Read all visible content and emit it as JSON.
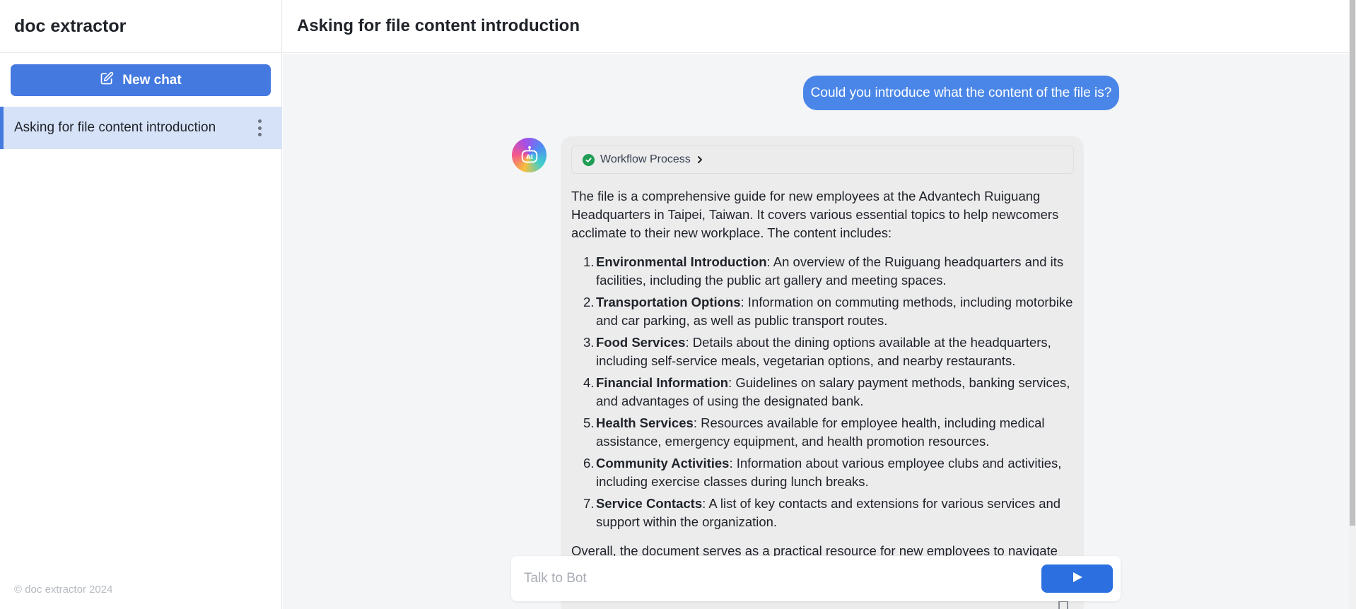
{
  "sidebar": {
    "app_title": "doc extractor",
    "new_chat_label": "New chat",
    "conversations": [
      {
        "label": "Asking for file content introduction",
        "active": true
      }
    ],
    "footer": "© doc extractor 2024"
  },
  "header": {
    "title": "Asking for file content introduction"
  },
  "chat": {
    "user_message": "Could you introduce what the content of the file is?",
    "bot": {
      "workflow_label": "Workflow Process",
      "intro": "The file is a comprehensive guide for new employees at the Advantech Ruiguang Headquarters in Taipei, Taiwan. It covers various essential topics to help newcomers acclimate to their new workplace. The content includes:",
      "items": [
        {
          "num": "1.",
          "title": "Environmental Introduction",
          "text": ": An overview of the Ruiguang headquarters and its facilities, including the public art gallery and meeting spaces."
        },
        {
          "num": "2.",
          "title": "Transportation Options",
          "text": ": Information on commuting methods, including motorbike and car parking, as well as public transport routes."
        },
        {
          "num": "3.",
          "title": "Food Services",
          "text": ": Details about the dining options available at the headquarters, including self-service meals, vegetarian options, and nearby restaurants."
        },
        {
          "num": "4.",
          "title": "Financial Information",
          "text": ": Guidelines on salary payment methods, banking services, and advantages of using the designated bank."
        },
        {
          "num": "5.",
          "title": "Health Services",
          "text": ": Resources available for employee health, including medical assistance, emergency equipment, and health promotion resources."
        },
        {
          "num": "6.",
          "title": "Community Activities",
          "text": ": Information about various employee clubs and activities, including exercise classes during lunch breaks."
        },
        {
          "num": "7.",
          "title": "Service Contacts",
          "text": ": A list of key contacts and extensions for various services and support within the organization."
        }
      ],
      "outro": "Overall, the document serves as a practical resource for new employees to navigate"
    }
  },
  "composer": {
    "placeholder": "Talk to Bot"
  },
  "colors": {
    "accent": "#4479e0",
    "user_bubble": "#4a86e8",
    "active_conversation": "#d6e2f7",
    "bot_bubble": "#ececed",
    "success": "#1f9d55"
  },
  "icons": {
    "new_chat": "edit-icon",
    "conversation_menu": "more-vertical-icon",
    "bot_avatar": "ai-bot-icon",
    "workflow_status": "check-circle-icon",
    "workflow_expand": "chevron-right-icon",
    "send": "send-icon",
    "copy": "clipboard-icon"
  }
}
